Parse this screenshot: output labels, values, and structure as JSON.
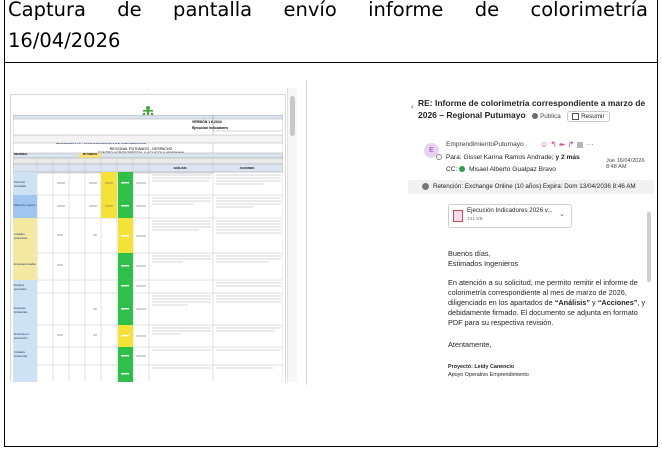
{
  "caption": {
    "line1": "Captura de pantalla envío informe de colorimetría",
    "line2": "16/04/2026"
  },
  "document": {
    "version_label": "VERSIÓN 1 6-2024",
    "doc_label": "Ejecución Indicadores",
    "title1": "PROCESO GESTIÓN PARA EL EMPRENDIMIENTO Y EL EMPRESARISMO",
    "title2": "SEGUIMIENTO - A LA EJECUCIÓN DE INDICADORES",
    "title3": "REGIONAL PUTUMAYO - DESPACHO",
    "title4": "CENTRO AGROFORESTAL Y ACUICOLA ARAPAIMA",
    "title5": "DIRECCIÓN GENERAL",
    "title6": "SERVICIO NACIONAL DE APRENDIZAJE",
    "section_label": "REGIONAL",
    "region_value": "PUTUMAYO",
    "analysis_header": "ANÁLISIS",
    "actions_header": "ACCIONES",
    "row_labels": [
      "Personas orientadas",
      "Planes de negocio",
      "Unidades productivas",
      "Empresas creadas",
      "Empleos generados",
      "Empresas fortalecidas",
      "Empresas en aceleración",
      "Unidades fortalecidas"
    ],
    "scroll_dots": "···"
  },
  "email": {
    "subject": "RE: Informe de colorimetría correspondiente a marzo de 2026 – Regional Putumayo",
    "visibility": "Pública",
    "summary_button": "Resumir",
    "avatar_letter": "E",
    "sender": "EmprendimientoPutumayo",
    "to_label": "Para:",
    "to_value": "Gissel Karina Ramos Andrade;",
    "to_more": "y 2 más",
    "date": "Jue 16/04/2026 8:48 AM",
    "cc_label": "CC:",
    "cc_value": "Misael Alberto Gualpaz Bravo",
    "retention": "Retención: Exchange Online (10 años) Expira: Dom 13/04/2036 8:46 AM",
    "attachment_name": "Ejecución Indicadores 2026 v...",
    "attachment_size": "131 KB",
    "greeting1": "Buenos días,",
    "greeting2": "Estimados Ingenieros",
    "body_pre": "En atención a su solicitud, me permito remitir el informe de colorimetría correspondiente al mes de marzo de 2026, diligenciado en los apartados de ",
    "body_b1": "“Análisis”",
    "body_mid": " y ",
    "body_b2": "“Acciones”",
    "body_post": ", y debidamente firmado. El documento se adjunta en formato PDF para su respectiva revisión.",
    "closing": "Atentamente,",
    "sig1": "Proyectó: Leidy Canencio",
    "sig2": "Apoyo Operativo Emprendimiento"
  }
}
